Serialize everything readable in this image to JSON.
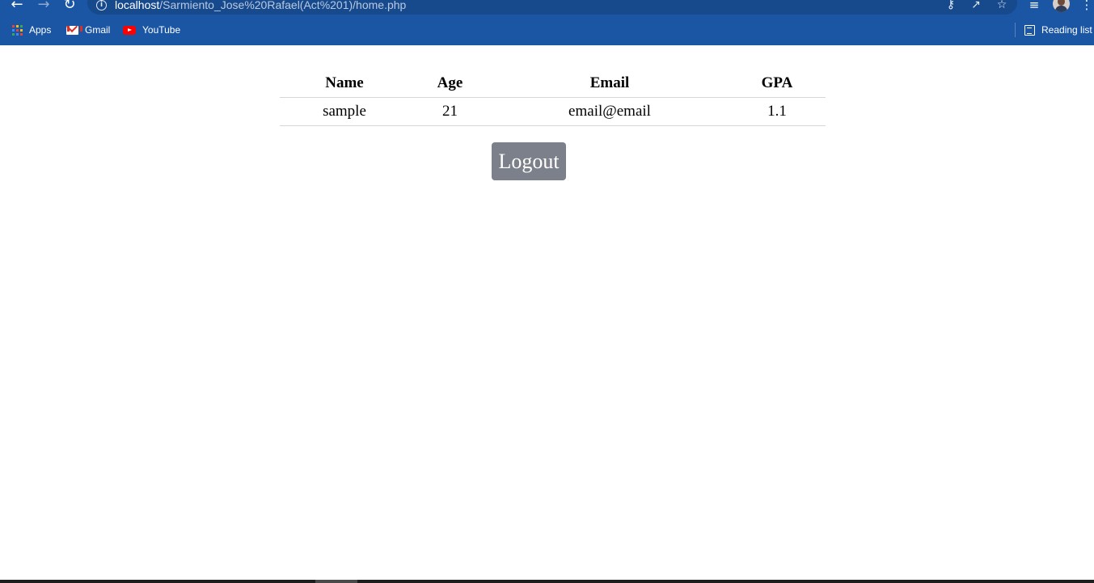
{
  "browser": {
    "url_host": "localhost",
    "url_path": "/Sarmiento_Jose%20Rafael(Act%201)/home.php",
    "bookmarks": [
      {
        "label": "Apps",
        "icon": "apps-grid-icon"
      },
      {
        "label": "Gmail",
        "icon": "gmail-icon"
      },
      {
        "label": "YouTube",
        "icon": "youtube-icon"
      }
    ],
    "reading_list_label": "Reading list",
    "colors": {
      "toolbar": "#1a56a3",
      "omnibox": "#174a8c"
    }
  },
  "table": {
    "headers": [
      "Name",
      "Age",
      "Email",
      "GPA"
    ],
    "rows": [
      [
        "sample",
        "21",
        "email@email",
        "1.1"
      ]
    ]
  },
  "logout_button": {
    "label": "Logout",
    "color": "#7c808a"
  }
}
